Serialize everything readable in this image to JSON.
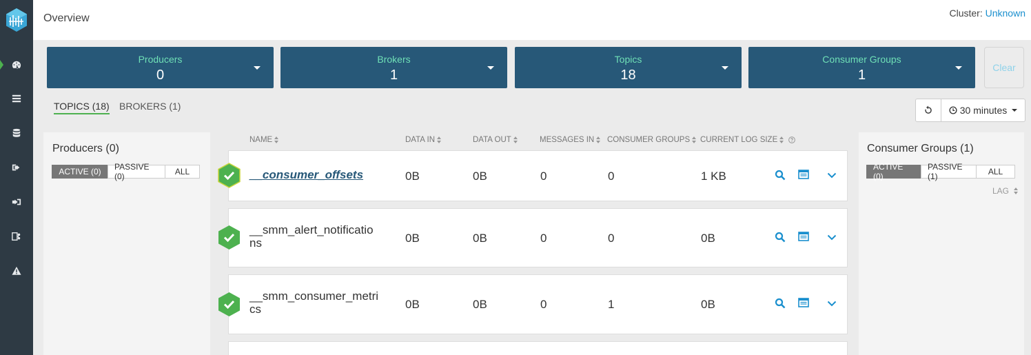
{
  "header": {
    "title": "Overview",
    "cluster_label": "Cluster:",
    "cluster_value": "Unknown"
  },
  "sidebar": {
    "items": [
      {
        "icon": "dashboard-icon",
        "active": true
      },
      {
        "icon": "list-icon"
      },
      {
        "icon": "database-icon"
      },
      {
        "icon": "sign-out-icon"
      },
      {
        "icon": "sign-in-icon"
      },
      {
        "icon": "topology-icon"
      },
      {
        "icon": "warning-icon"
      }
    ]
  },
  "stats": [
    {
      "label": "Producers",
      "value": "0"
    },
    {
      "label": "Brokers",
      "value": "1"
    },
    {
      "label": "Topics",
      "value": "18"
    },
    {
      "label": "Consumer Groups",
      "value": "1"
    }
  ],
  "clear_label": "Clear",
  "tabs": {
    "topics": "TOPICS (18)",
    "brokers": "BROKERS (1)"
  },
  "time_range": "30 minutes",
  "producers_panel": {
    "title": "Producers (0)",
    "filters": [
      "ACTIVE (0)",
      "PASSIVE (0)",
      "ALL"
    ]
  },
  "consumers_panel": {
    "title": "Consumer Groups (1)",
    "filters": [
      "ACTIVE (0)",
      "PASSIVE (1)",
      "ALL"
    ],
    "lag_label": "LAG"
  },
  "table": {
    "columns": [
      "NAME",
      "DATA IN",
      "DATA OUT",
      "MESSAGES IN",
      "CONSUMER GROUPS",
      "CURRENT LOG SIZE"
    ],
    "rows": [
      {
        "name_line1": "__consumer_offsets",
        "name_line2": "",
        "data_in": "0B",
        "data_out": "0B",
        "messages_in": "0",
        "consumer_groups": "0",
        "log_size": "1 KB"
      },
      {
        "name_line1": "__smm_alert_notificatio",
        "name_line2": "ns",
        "data_in": "0B",
        "data_out": "0B",
        "messages_in": "0",
        "consumer_groups": "0",
        "log_size": "0B"
      },
      {
        "name_line1": "__smm_consumer_metri",
        "name_line2": "cs",
        "data_in": "0B",
        "data_out": "0B",
        "messages_in": "0",
        "consumer_groups": "1",
        "log_size": "0B"
      }
    ]
  },
  "colors": {
    "sidebar": "#2e3a44",
    "card": "#275878",
    "card_label": "#6fe0b6",
    "status_ok": "#4db14f",
    "link": "#1a8fce"
  }
}
